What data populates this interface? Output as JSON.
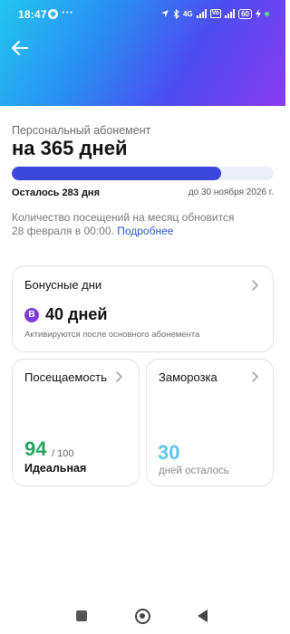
{
  "status_bar": {
    "time": "18:47",
    "dots": "···",
    "network": "4G",
    "volte": "Vo",
    "battery": "60"
  },
  "header": {
    "back_icon": "arrow-left-icon",
    "gradient_colors": [
      "#22c6f0",
      "#4d4cf0",
      "#8a3bf0"
    ]
  },
  "subscription": {
    "subtitle": "Персональный абонемент",
    "title": "на 365 дней",
    "progress_fraction": 0.8,
    "progress_color": "#3b46dc",
    "remaining": "Осталось 283 дня",
    "until": "до 30 ноября 2026 г."
  },
  "notice": {
    "text": "Количество посещений на месяц обновится 28 февраля в 00:00.",
    "link": "Подробнее"
  },
  "bonus": {
    "title": "Бонусные дни",
    "badge": "B",
    "value": "40 дней",
    "note": "Активируются после основного абонемента"
  },
  "attendance": {
    "title": "Посещаемость",
    "score": "94",
    "max": "/ 100",
    "label": "Идеальная"
  },
  "freeze": {
    "title": "Заморозка",
    "value": "30",
    "note": "дней осталось"
  }
}
